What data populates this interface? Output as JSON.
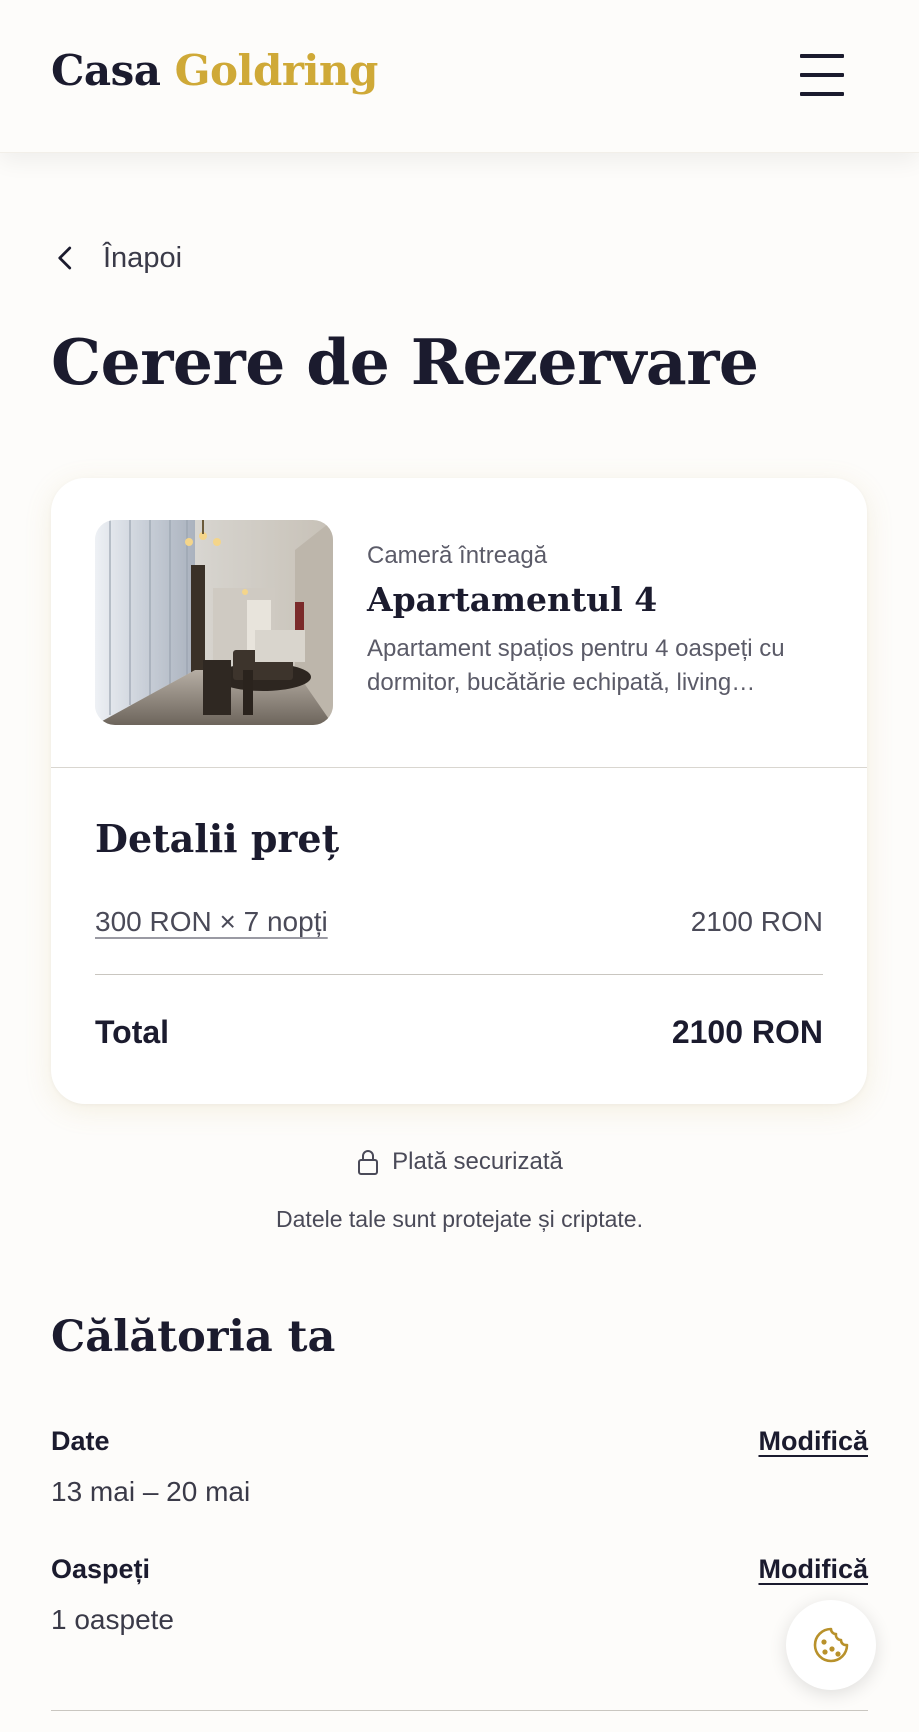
{
  "header": {
    "brand_part1": "Casa",
    "brand_part2": "Goldring",
    "menu_icon": "hamburger-menu-icon"
  },
  "nav": {
    "back_label": "Înapoi",
    "back_icon": "chevron-left-icon"
  },
  "page": {
    "title": "Cerere de Rezervare"
  },
  "listing": {
    "type": "Cameră întreagă",
    "name": "Apartamentul 4",
    "description": "Apartament spațios pentru 4 oaspeți cu dormitor, bucătărie echipată, living…"
  },
  "price": {
    "title": "Detalii preț",
    "line_label": "300 RON × 7 nopți",
    "line_amount": "2100 RON",
    "total_label": "Total",
    "total_amount": "2100 RON"
  },
  "security": {
    "label": "Plată securizată",
    "icon": "lock-icon",
    "note": "Datele tale sunt protejate și criptate."
  },
  "trip": {
    "title": "Călătoria ta",
    "dates_label": "Date",
    "dates_value": "13 mai – 20 mai",
    "dates_action": "Modifică",
    "guests_label": "Oaspeți",
    "guests_value": "1 oaspete",
    "guests_action": "Modifică"
  },
  "floating": {
    "cookie_icon": "cookie-icon"
  },
  "colors": {
    "brand_gold": "#cfa937",
    "text_dark": "#1b1b2e",
    "background": "#fdfcfa"
  }
}
